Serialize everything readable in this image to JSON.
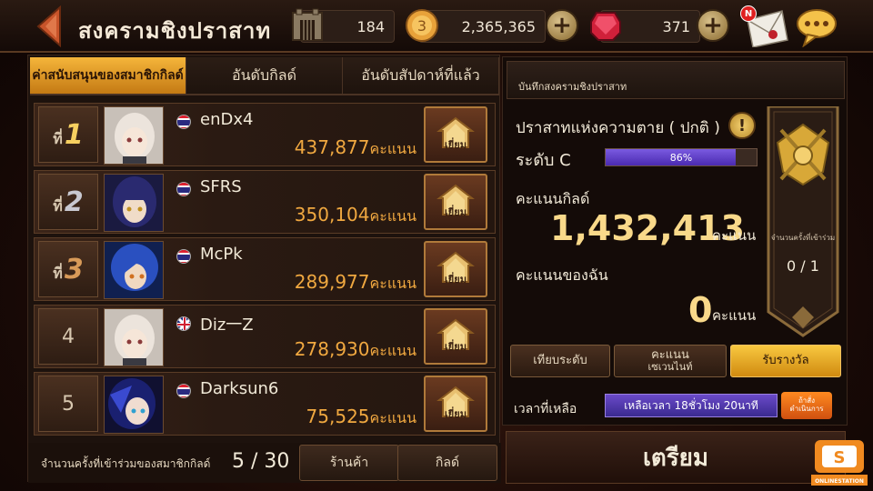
{
  "header": {
    "title": "สงครามชิงปราสาท",
    "castle_count": "184",
    "gold": "2,365,365",
    "gems": "371",
    "mail_badge": "N"
  },
  "tabs": [
    {
      "label": "ค่าสนับสนุนของสมาชิกกิลด์",
      "active": true
    },
    {
      "label": "อันดับกิลด์",
      "active": false
    },
    {
      "label": "อันดับสัปดาห์ที่แล้ว",
      "active": false
    }
  ],
  "rank_prefix": "ที่",
  "score_unit": "คะแนน",
  "visit_label": "เยี่ยม",
  "rankings": [
    {
      "rank": "1",
      "name": "enDx4",
      "score": "437,877",
      "flag": "th"
    },
    {
      "rank": "2",
      "name": "SFRS",
      "score": "350,104",
      "flag": "th"
    },
    {
      "rank": "3",
      "name": "McPk",
      "score": "289,977",
      "flag": "th"
    },
    {
      "rank": "4",
      "name": "Diz一Z",
      "score": "278,930",
      "flag": "uk"
    },
    {
      "rank": "5",
      "name": "Darksun6",
      "score": "75,525",
      "flag": "th"
    }
  ],
  "left_footer": {
    "participation_label": "จำนวนครั้งที่เข้าร่วมของสมาชิกกิลด์",
    "participation_value": "5 / 30",
    "shop_label": "ร้านค้า",
    "guild_label": "กิลด์"
  },
  "right_panel": {
    "header": "บันทึกสงครามชิงปราสาท",
    "castle_name": "ปราสาทแห่งความตาย ( ปกติ )",
    "level_label": "ระดับ C",
    "progress_percent": 86,
    "progress_text": "86%",
    "guild_score_label": "คะแนนกิลด์",
    "guild_score": "1,432,413",
    "my_score_label": "คะแนนของฉัน",
    "my_score": "0",
    "score_unit": "คะแนน",
    "banner_label": "จำนวนครั้งที่เข้าร่วม",
    "banner_count": "0 / 1",
    "btn_compare": "เทียบระดับ",
    "btn_season_score_line1": "คะแนน",
    "btn_season_score_line2": "เซเวนไนท์",
    "btn_reward": "รับรางวัล",
    "time_label": "เวลาที่เหลือ",
    "time_remaining": "เหลือเวลา 18ชั่วโมง 20นาที",
    "time_btn_line1": "ถ้าสั่ง",
    "time_btn_line2": "ดำเนินการ",
    "prepare_label": "เตรียม"
  },
  "colors": {
    "accent_gold": "#f0a840",
    "tab_active": "#e8a02a",
    "progress": "#6a4ad8"
  }
}
